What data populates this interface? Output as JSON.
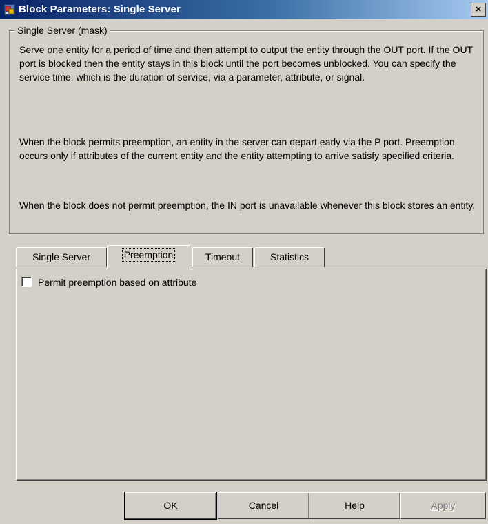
{
  "window": {
    "title": "Block Parameters: Single Server",
    "close_glyph": "×"
  },
  "mask": {
    "group_title": "Single Server (mask)",
    "paragraphs": [
      "Serve one entity for a period of time and then attempt to output the entity through the OUT port. If the OUT port is blocked then the entity stays in this block until the port becomes unblocked. You can specify the service time, which is the duration of service, via a parameter, attribute, or signal.",
      "When the block permits preemption, an entity in the server can depart early via the P port. Preemption occurs only if attributes of the current entity and the entity attempting to arrive satisfy specified criteria.",
      "When the block does not permit preemption, the IN port is unavailable whenever this block stores an entity."
    ]
  },
  "tabs": [
    {
      "label": "Single Server",
      "active": false
    },
    {
      "label": "Preemption",
      "active": true
    },
    {
      "label": "Timeout",
      "active": false
    },
    {
      "label": "Statistics",
      "active": false
    }
  ],
  "preemption_panel": {
    "checkbox_label": "Permit preemption based on attribute",
    "checked": false
  },
  "buttons": {
    "ok": {
      "mnemonic": "O",
      "rest": "K"
    },
    "cancel": {
      "mnemonic": "C",
      "rest": "ancel"
    },
    "help": {
      "mnemonic": "H",
      "rest": "elp"
    },
    "apply": {
      "mnemonic": "A",
      "rest": "pply",
      "enabled": false
    }
  },
  "icons": {
    "app_icon": "simulink-block-icon",
    "close_icon": "close-icon"
  }
}
